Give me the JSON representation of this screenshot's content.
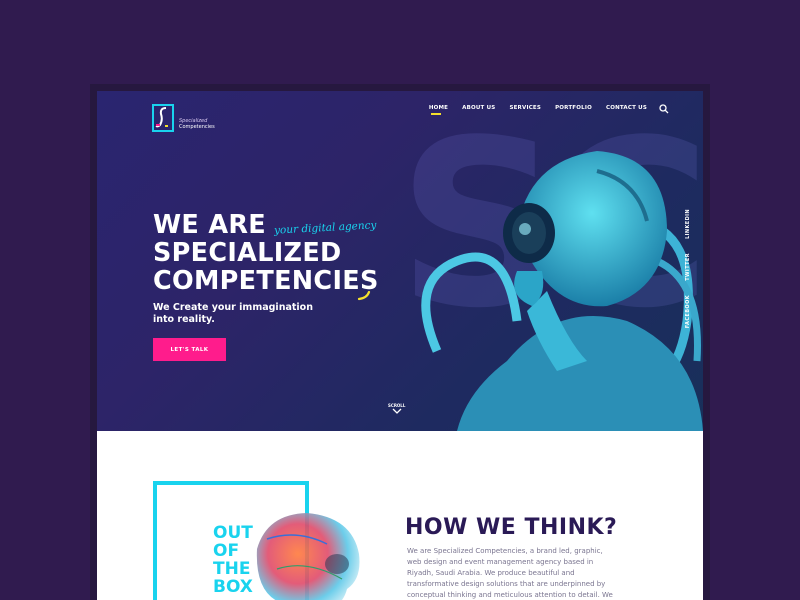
{
  "brand": {
    "name_line1": "Specialized",
    "name_line2": "Competencies",
    "logo_icon": "logo-s-icon"
  },
  "nav": {
    "items": [
      {
        "label": "HOME"
      },
      {
        "label": "ABOUT US"
      },
      {
        "label": "SERVICES"
      },
      {
        "label": "PORTFOLIO"
      },
      {
        "label": "CONTACT US"
      }
    ],
    "search_icon": "search-icon"
  },
  "hero": {
    "line1": "WE ARE",
    "line2": "SPECIALIZED",
    "line3": "COMPETENCIES",
    "tagline": "your digital agency",
    "sub_line1": "We Create your immagination",
    "sub_line2": "into reality.",
    "cta": "LET'S TALK",
    "scroll": "SCROLL",
    "bg_letters": "SC"
  },
  "social": {
    "items": [
      "LINKEDIN",
      "TWITTER",
      "FACEBOOK"
    ]
  },
  "section2": {
    "box_text": [
      "OUT",
      "OF",
      "THE",
      "BOX"
    ],
    "heading": "HOW WE THINK?",
    "paragraph": "We are Specialized Competencies, a brand led, graphic, web design and event management agency based in Riyadh, Saudi Arabia. We produce beautiful and transformative design solutions that are underpinned by conceptual thinking and meticulous attention to detail. We apply this philosophy across"
  },
  "colors": {
    "bg": "#301b4f",
    "accent": "#19d3ee",
    "cta": "#ff1c8c",
    "highlight": "#f5e02c"
  }
}
